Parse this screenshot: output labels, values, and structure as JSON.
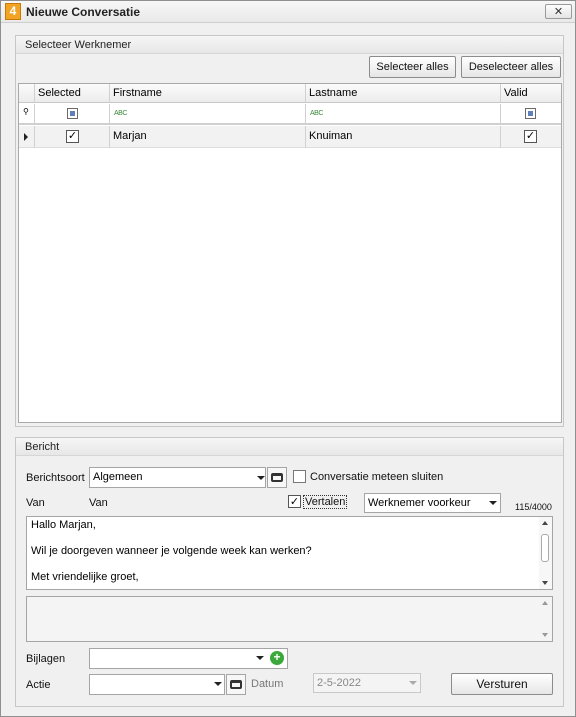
{
  "window": {
    "app_icon_text": "4",
    "title": "Nieuwe Conversatie",
    "close_icon": "close-icon"
  },
  "employee_group": {
    "caption": "Selecteer Werknemer",
    "select_all": "Selecteer alles",
    "deselect_all": "Deselecteer alles",
    "columns": [
      "Selected",
      "Firstname",
      "Lastname",
      "Valid"
    ],
    "filter_abc": "ABC",
    "rows": [
      {
        "selected": true,
        "firstname": "Marjan",
        "lastname": "Knuiman",
        "valid": true
      }
    ]
  },
  "message_group": {
    "caption": "Bericht",
    "type_label": "Berichtsoort",
    "type_value": "Algemeen",
    "close_conversation_label": "Conversatie meteen sluiten",
    "close_conversation_checked": false,
    "from_label": "Van",
    "from_value": "Van",
    "translate_label": "Vertalen",
    "translate_checked": true,
    "translate_option": "Werknemer voorkeur",
    "char_count": "115/4000",
    "body_lines": [
      "Hallo Marjan,",
      "",
      "Wil je doorgeven wanneer je volgende week kan werken?",
      "",
      "Met vriendelijke groet,"
    ],
    "attachments_label": "Bijlagen",
    "action_label": "Actie",
    "date_label": "Datum",
    "date_value": "2-5-2022",
    "send_label": "Versturen"
  }
}
